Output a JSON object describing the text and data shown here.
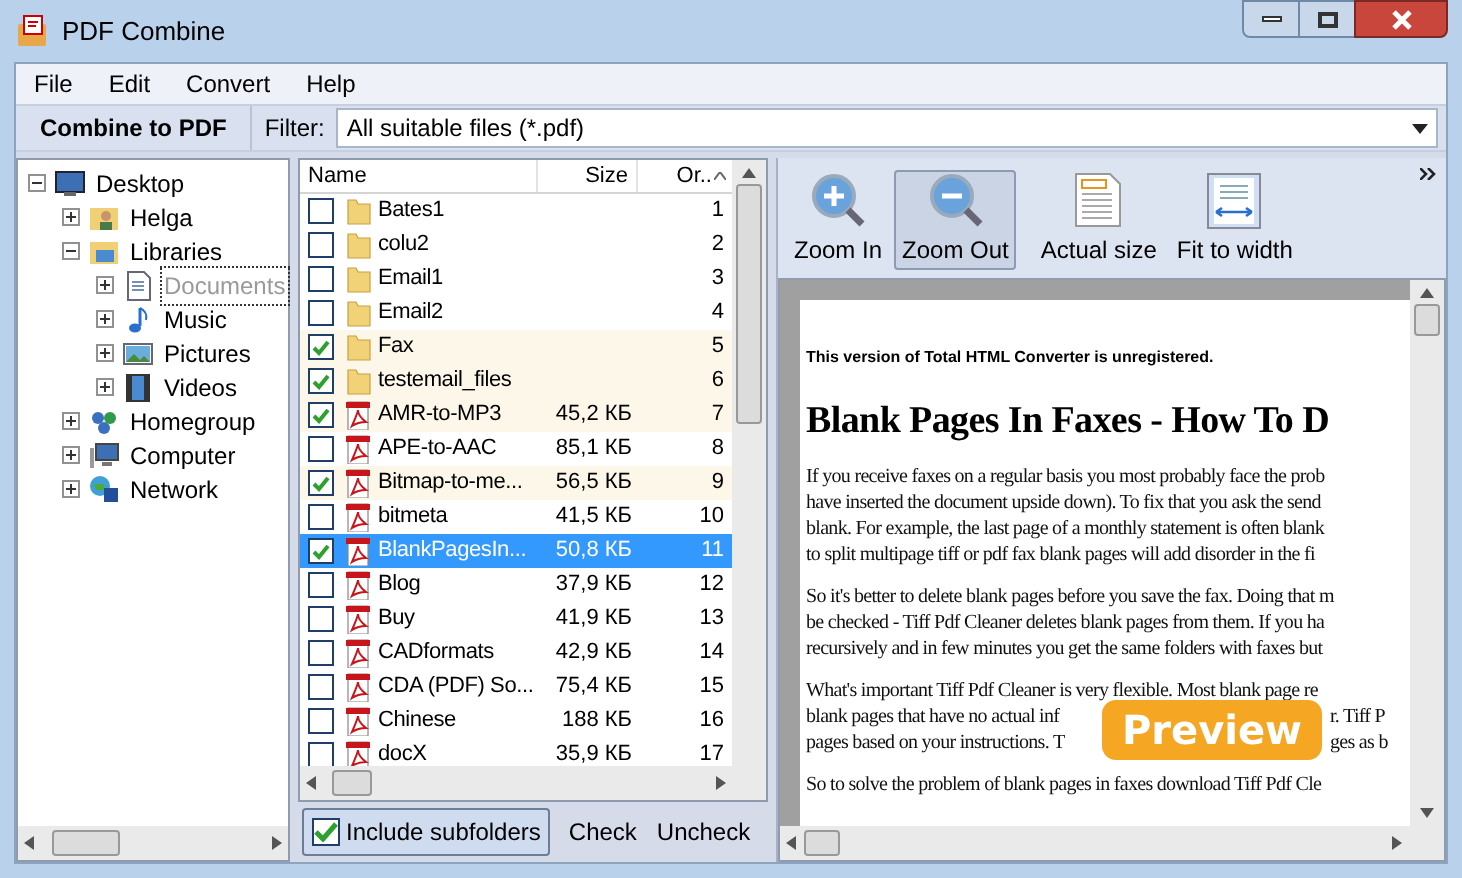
{
  "window": {
    "title": "PDF Combine"
  },
  "menu": [
    "File",
    "Edit",
    "Convert",
    "Help"
  ],
  "toolbar": {
    "combine_button": "Combine to PDF",
    "filter_label": "Filter:",
    "filter_value": "All suitable files (*.pdf)"
  },
  "tree": [
    {
      "label": "Desktop",
      "kind": "desktop",
      "expanded": true,
      "selected": false,
      "children": [
        {
          "label": "Helga",
          "kind": "user",
          "expanded": false,
          "selected": false
        },
        {
          "label": "Libraries",
          "kind": "library",
          "expanded": true,
          "selected": false,
          "children": [
            {
              "label": "Documents",
              "kind": "document",
              "expanded": false,
              "selected": true
            },
            {
              "label": "Music",
              "kind": "music",
              "expanded": false,
              "selected": false
            },
            {
              "label": "Pictures",
              "kind": "pictures",
              "expanded": false,
              "selected": false
            },
            {
              "label": "Videos",
              "kind": "videos",
              "expanded": false,
              "selected": false
            }
          ]
        },
        {
          "label": "Homegroup",
          "kind": "homegroup",
          "expanded": false,
          "selected": false
        },
        {
          "label": "Computer",
          "kind": "computer",
          "expanded": false,
          "selected": false
        },
        {
          "label": "Network",
          "kind": "network",
          "expanded": false,
          "selected": false
        }
      ]
    }
  ],
  "file_list": {
    "columns": [
      "Name",
      "Size",
      "Or.."
    ],
    "rows": [
      {
        "kind": "folder",
        "checked": false,
        "selected": false,
        "name": "Bates1",
        "size": "",
        "order": "1"
      },
      {
        "kind": "folder",
        "checked": false,
        "selected": false,
        "name": "colu2",
        "size": "",
        "order": "2"
      },
      {
        "kind": "folder",
        "checked": false,
        "selected": false,
        "name": "Email1",
        "size": "",
        "order": "3"
      },
      {
        "kind": "folder",
        "checked": false,
        "selected": false,
        "name": "Email2",
        "size": "",
        "order": "4"
      },
      {
        "kind": "folder",
        "checked": true,
        "selected": false,
        "name": "Fax",
        "size": "",
        "order": "5"
      },
      {
        "kind": "folder",
        "checked": true,
        "selected": false,
        "name": "testemail_files",
        "size": "",
        "order": "6"
      },
      {
        "kind": "pdf",
        "checked": true,
        "selected": false,
        "name": "AMR-to-MP3",
        "size": "45,2 КБ",
        "order": "7"
      },
      {
        "kind": "pdf",
        "checked": false,
        "selected": false,
        "name": "APE-to-AAC",
        "size": "85,1 КБ",
        "order": "8"
      },
      {
        "kind": "pdf",
        "checked": true,
        "selected": false,
        "name": "Bitmap-to-me...",
        "size": "56,5 КБ",
        "order": "9"
      },
      {
        "kind": "pdf",
        "checked": false,
        "selected": false,
        "name": "bitmeta",
        "size": "41,5 КБ",
        "order": "10"
      },
      {
        "kind": "pdf",
        "checked": true,
        "selected": true,
        "name": "BlankPagesIn...",
        "size": "50,8 КБ",
        "order": "11"
      },
      {
        "kind": "pdf",
        "checked": false,
        "selected": false,
        "name": "Blog",
        "size": "37,9 КБ",
        "order": "12"
      },
      {
        "kind": "pdf",
        "checked": false,
        "selected": false,
        "name": "Buy",
        "size": "41,9 КБ",
        "order": "13"
      },
      {
        "kind": "pdf",
        "checked": false,
        "selected": false,
        "name": "CADformats",
        "size": "42,9 КБ",
        "order": "14"
      },
      {
        "kind": "pdf",
        "checked": false,
        "selected": false,
        "name": "CDA (PDF) So...",
        "size": "75,4 КБ",
        "order": "15"
      },
      {
        "kind": "pdf",
        "checked": false,
        "selected": false,
        "name": "Chinese",
        "size": "188 КБ",
        "order": "16"
      },
      {
        "kind": "pdf",
        "checked": false,
        "selected": false,
        "name": "docX",
        "size": "35,9 КБ",
        "order": "17"
      }
    ]
  },
  "list_footer": {
    "include_subfolders": {
      "label": "Include subfolders",
      "checked": true
    },
    "check": "Check",
    "uncheck": "Uncheck"
  },
  "viewer_toolbar": [
    {
      "kind": "zoom-in",
      "label": "Zoom In",
      "selected": false
    },
    {
      "kind": "zoom-out",
      "label": "Zoom Out",
      "selected": true
    },
    {
      "kind": "actual-size",
      "label": "Actual size",
      "selected": false
    },
    {
      "kind": "fit-width",
      "label": "Fit to width",
      "selected": false
    }
  ],
  "document": {
    "notice": "This version of Total HTML Converter is unregistered.",
    "heading": "Blank Pages In Faxes - How To D",
    "paragraphs": [
      [
        "If you receive faxes on a regular basis you most probably face the prob",
        "have inserted the document upside down). To fix that you ask the send",
        "blank. For example, the last page of a monthly statement is often blank",
        "to split multipage tiff or pdf fax blank pages will add disorder in the fi"
      ],
      [
        "So it's better to delete blank pages before you save the fax. Doing that m",
        "be checked - Tiff Pdf Cleaner deletes blank pages from them. If you ha",
        "recursively and in few minutes you get the same folders with faxes but"
      ],
      [
        "What's important Tiff Pdf Cleaner is very flexible. Most blank page re",
        "blank pages that have no actual inf",
        "pages based on your instructions. T"
      ],
      [
        "So to solve the problem of blank pages in faxes download Tiff Pdf Cle"
      ]
    ],
    "covered_line_ends": [
      "r. Tiff P",
      "ges as b"
    ],
    "badge": "Preview"
  }
}
